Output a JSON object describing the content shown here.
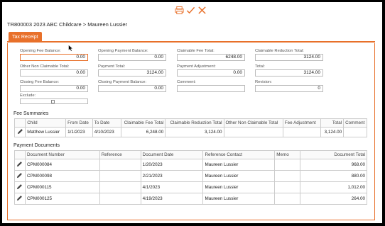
{
  "breadcrumb": "TR800003 2023 ABC Childcare > Maureen Lussier",
  "toolbar": {
    "icons": [
      "print-icon",
      "checkmark-icon",
      "close-icon"
    ],
    "color": "#e8702a"
  },
  "tabs": [
    {
      "label": "Tax Receipt"
    }
  ],
  "fields": {
    "opening_fee_balance": {
      "label": "Opening Fee Balance:",
      "value": "0.00"
    },
    "opening_payment_balance": {
      "label": "Opening Payment Balance:",
      "value": "0.00"
    },
    "claimable_fee_total": {
      "label": "Claimable Fee Total:",
      "value": "6248.00"
    },
    "claimable_reduction_total": {
      "label": "Claimable Reduction Total:",
      "value": "3124.00"
    },
    "other_non_claimable_total": {
      "label": "Other Non Claimable Total:",
      "value": "0.00"
    },
    "payment_total": {
      "label": "Payment Total:",
      "value": "3124.00"
    },
    "payment_adjustment": {
      "label": "Payment Adjustment:",
      "value": "0.00"
    },
    "total": {
      "label": "Total:",
      "value": "3124.00"
    },
    "closing_fee_balance": {
      "label": "Closing Fee Balance:",
      "value": "0.00"
    },
    "closing_payment_balance": {
      "label": "Closing Payment Balance:",
      "value": "0.00"
    },
    "comment": {
      "label": "Comment:",
      "value": ""
    },
    "revision": {
      "label": "Revision:",
      "value": "0"
    },
    "exclude": {
      "label": "Exclude:",
      "checked": false
    }
  },
  "fee_summaries": {
    "title": "Fee Summaries",
    "columns": [
      "",
      "Child",
      "From Date",
      "To Date",
      "Claimable Fee Total",
      "Claimable Reduction Total",
      "Other Non Claimable Total",
      "Fee Adjustment",
      "Total",
      "Comment"
    ],
    "rows": [
      [
        "Matthew Lussier",
        "1/1/2023",
        "4/10/2023",
        "6,248.00",
        "3,124.00",
        "",
        "",
        "3,124.00",
        ""
      ]
    ]
  },
  "payment_documents": {
    "title": "Payment Documents",
    "columns": [
      "",
      "Document Number",
      "Reference",
      "Document Date",
      "Reference Contact",
      "Memo",
      "Document Total"
    ],
    "rows": [
      [
        "CPM000084",
        "",
        "1/20/2023",
        "Maureen Lussier",
        "",
        "968.00"
      ],
      [
        "CPM000098",
        "",
        "2/21/2023",
        "Maureen Lussier",
        "",
        "880.00"
      ],
      [
        "CPM000115",
        "",
        "4/1/2023",
        "Maureen Lussier",
        "",
        "1,012.00"
      ],
      [
        "CPM000125",
        "",
        "4/19/2023",
        "Maureen Lussier",
        "",
        "264.00"
      ]
    ]
  }
}
